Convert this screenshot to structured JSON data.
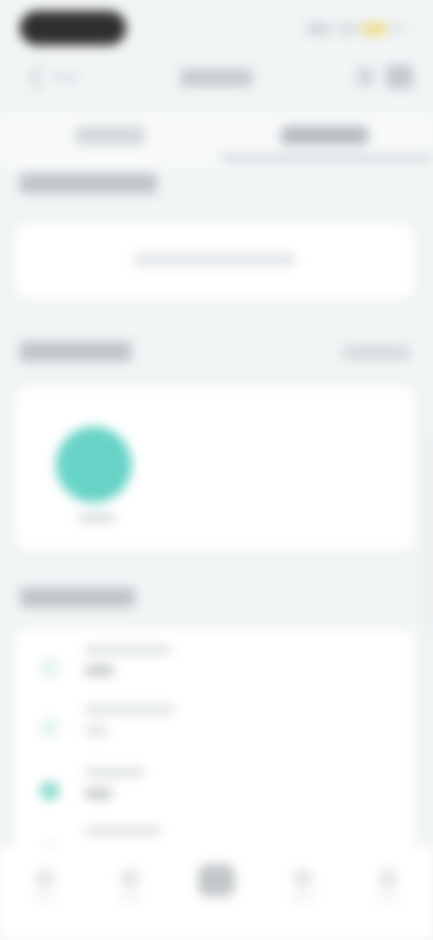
{
  "colors": {
    "background": "#f2f5f6",
    "card": "#ffffff",
    "accent": "#67d3c6",
    "status_pill": "#2f2f2f",
    "battery": "#f0d77a"
  },
  "icons": {
    "back": "chevron-left-icon",
    "header_action_1": "search-icon",
    "header_action_2": "more-icon",
    "bottom_nav": [
      "home-icon",
      "list-icon",
      "center-icon",
      "message-icon",
      "profile-icon"
    ]
  },
  "list_items_count_visible": 4
}
